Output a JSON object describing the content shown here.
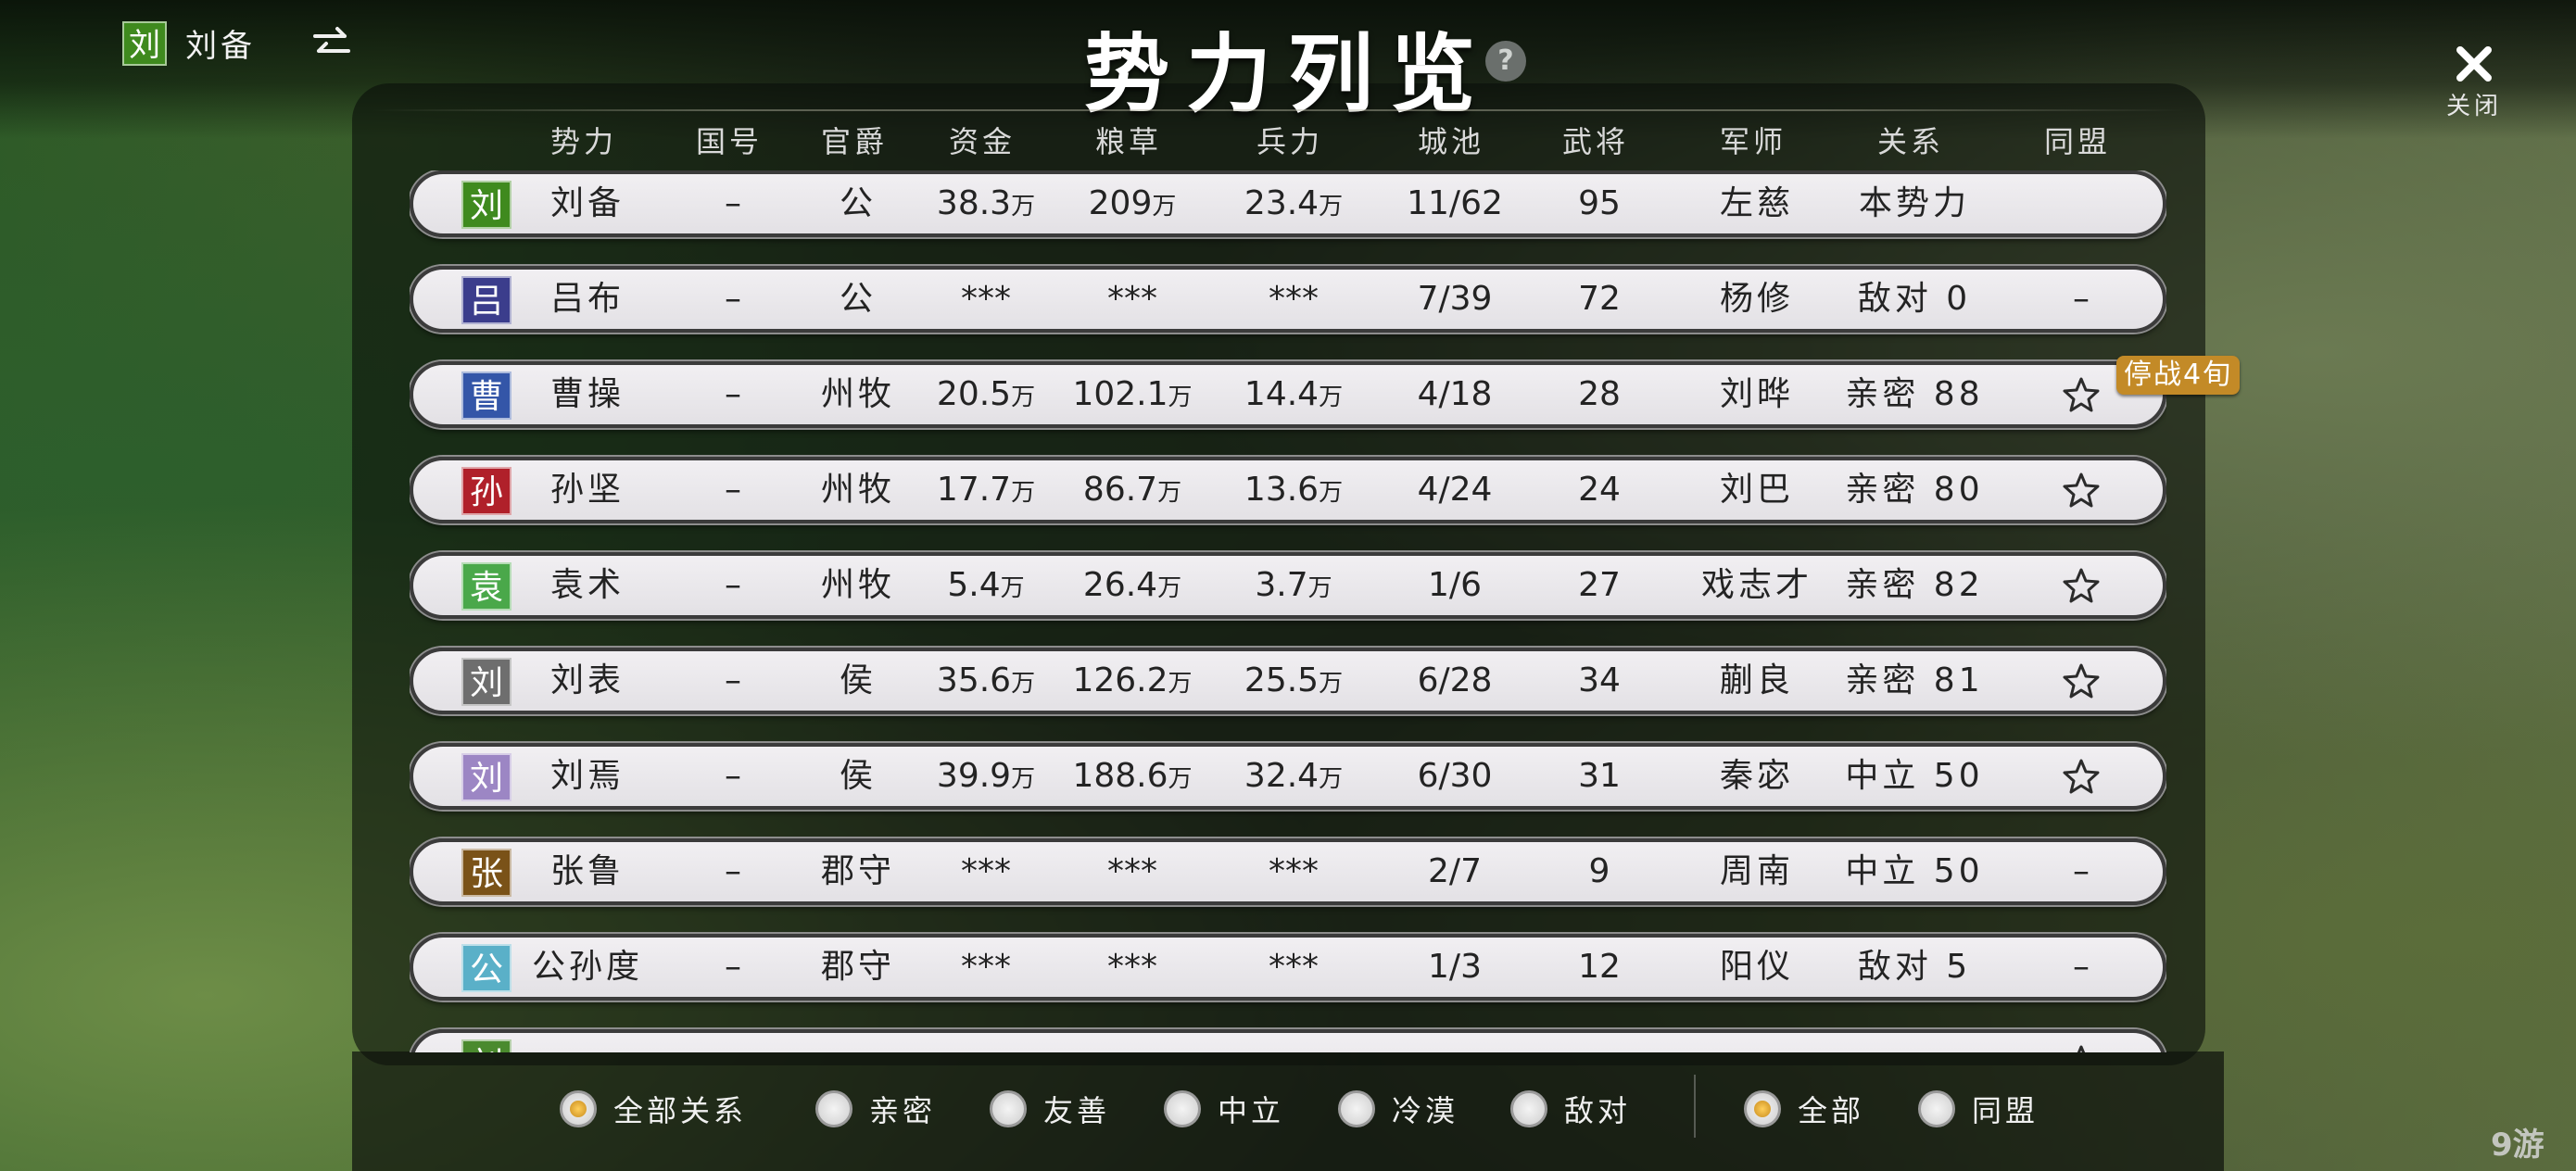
{
  "player": {
    "chip": "刘",
    "chip_color": "#3f8a1e",
    "name": "刘备"
  },
  "title": "势力列览",
  "help_label": "?",
  "close_label": "关闭",
  "columns": [
    {
      "label": "势力",
      "x": 0
    },
    {
      "label": "国号",
      "x": 0
    },
    {
      "label": "官爵",
      "x": 0
    },
    {
      "label": "资金",
      "x": 0
    },
    {
      "label": "粮草",
      "x": 0
    },
    {
      "label": "兵力",
      "x": 0
    },
    {
      "label": "城池",
      "x": 0
    },
    {
      "label": "武将",
      "x": 0
    },
    {
      "label": "军师",
      "x": 0
    },
    {
      "label": "关系",
      "x": 0
    },
    {
      "label": "同盟",
      "x": 0
    }
  ],
  "unit": "万",
  "rows": [
    {
      "chip": "刘",
      "chip_color": "#3f8a1e",
      "name": "刘备",
      "kingdom": "–",
      "rank": "公",
      "funds": "38.3",
      "food": "209",
      "troops": "23.4",
      "cities": "11/62",
      "generals": "95",
      "advisor": "左慈",
      "relation": "本势力",
      "alliance": ""
    },
    {
      "chip": "吕",
      "chip_color": "#3b3d8c",
      "name": "吕布",
      "kingdom": "–",
      "rank": "公",
      "funds": "***",
      "food": "***",
      "troops": "***",
      "cities": "7/39",
      "generals": "72",
      "advisor": "杨修",
      "relation": "敌对 0",
      "alliance": "–"
    },
    {
      "chip": "曹",
      "chip_color": "#3456a8",
      "name": "曹操",
      "kingdom": "–",
      "rank": "州牧",
      "funds": "20.5",
      "food": "102.1",
      "troops": "14.4",
      "cities": "4/18",
      "generals": "28",
      "advisor": "刘晔",
      "relation": "亲密 88",
      "alliance": "star"
    },
    {
      "chip": "孙",
      "chip_color": "#b0202a",
      "name": "孙坚",
      "kingdom": "–",
      "rank": "州牧",
      "funds": "17.7",
      "food": "86.7",
      "troops": "13.6",
      "cities": "4/24",
      "generals": "24",
      "advisor": "刘巴",
      "relation": "亲密 80",
      "alliance": "star"
    },
    {
      "chip": "袁",
      "chip_color": "#4aa84a",
      "name": "袁术",
      "kingdom": "–",
      "rank": "州牧",
      "funds": "5.4",
      "food": "26.4",
      "troops": "3.7",
      "cities": "1/6",
      "generals": "27",
      "advisor": "戏志才",
      "relation": "亲密 82",
      "alliance": "star"
    },
    {
      "chip": "刘",
      "chip_color": "#6e6e6e",
      "name": "刘表",
      "kingdom": "–",
      "rank": "侯",
      "funds": "35.6",
      "food": "126.2",
      "troops": "25.5",
      "cities": "6/28",
      "generals": "34",
      "advisor": "蒯良",
      "relation": "亲密 81",
      "alliance": "star"
    },
    {
      "chip": "刘",
      "chip_color": "#9c86c4",
      "name": "刘焉",
      "kingdom": "–",
      "rank": "侯",
      "funds": "39.9",
      "food": "188.6",
      "troops": "32.4",
      "cities": "6/30",
      "generals": "31",
      "advisor": "秦宓",
      "relation": "中立 50",
      "alliance": "star"
    },
    {
      "chip": "张",
      "chip_color": "#7a5218",
      "name": "张鲁",
      "kingdom": "–",
      "rank": "郡守",
      "funds": "***",
      "food": "***",
      "troops": "***",
      "cities": "2/7",
      "generals": "9",
      "advisor": "周南",
      "relation": "中立 50",
      "alliance": "–"
    },
    {
      "chip": "公",
      "chip_color": "#5ab0c8",
      "name": "公孙度",
      "kingdom": "–",
      "rank": "郡守",
      "funds": "***",
      "food": "***",
      "troops": "***",
      "cities": "1/3",
      "generals": "12",
      "advisor": "阳仪",
      "relation": "敌对 5",
      "alliance": "–"
    },
    {
      "chip": "刘",
      "chip_color": "#4a8a2e",
      "name": "",
      "kingdom": "",
      "rank": "",
      "funds": "",
      "food": "",
      "troops": "",
      "cities": "",
      "generals": "",
      "advisor": "",
      "relation": "",
      "alliance": "star"
    }
  ],
  "truce_badge": "停战4旬",
  "filters": {
    "relation": [
      {
        "label": "全部关系",
        "selected": true
      },
      {
        "label": "亲密",
        "selected": false
      },
      {
        "label": "友善",
        "selected": false
      },
      {
        "label": "中立",
        "selected": false
      },
      {
        "label": "冷漠",
        "selected": false
      },
      {
        "label": "敌对",
        "selected": false
      }
    ],
    "scope": [
      {
        "label": "全部",
        "selected": true
      },
      {
        "label": "同盟",
        "selected": false
      }
    ]
  },
  "watermark": "九游"
}
